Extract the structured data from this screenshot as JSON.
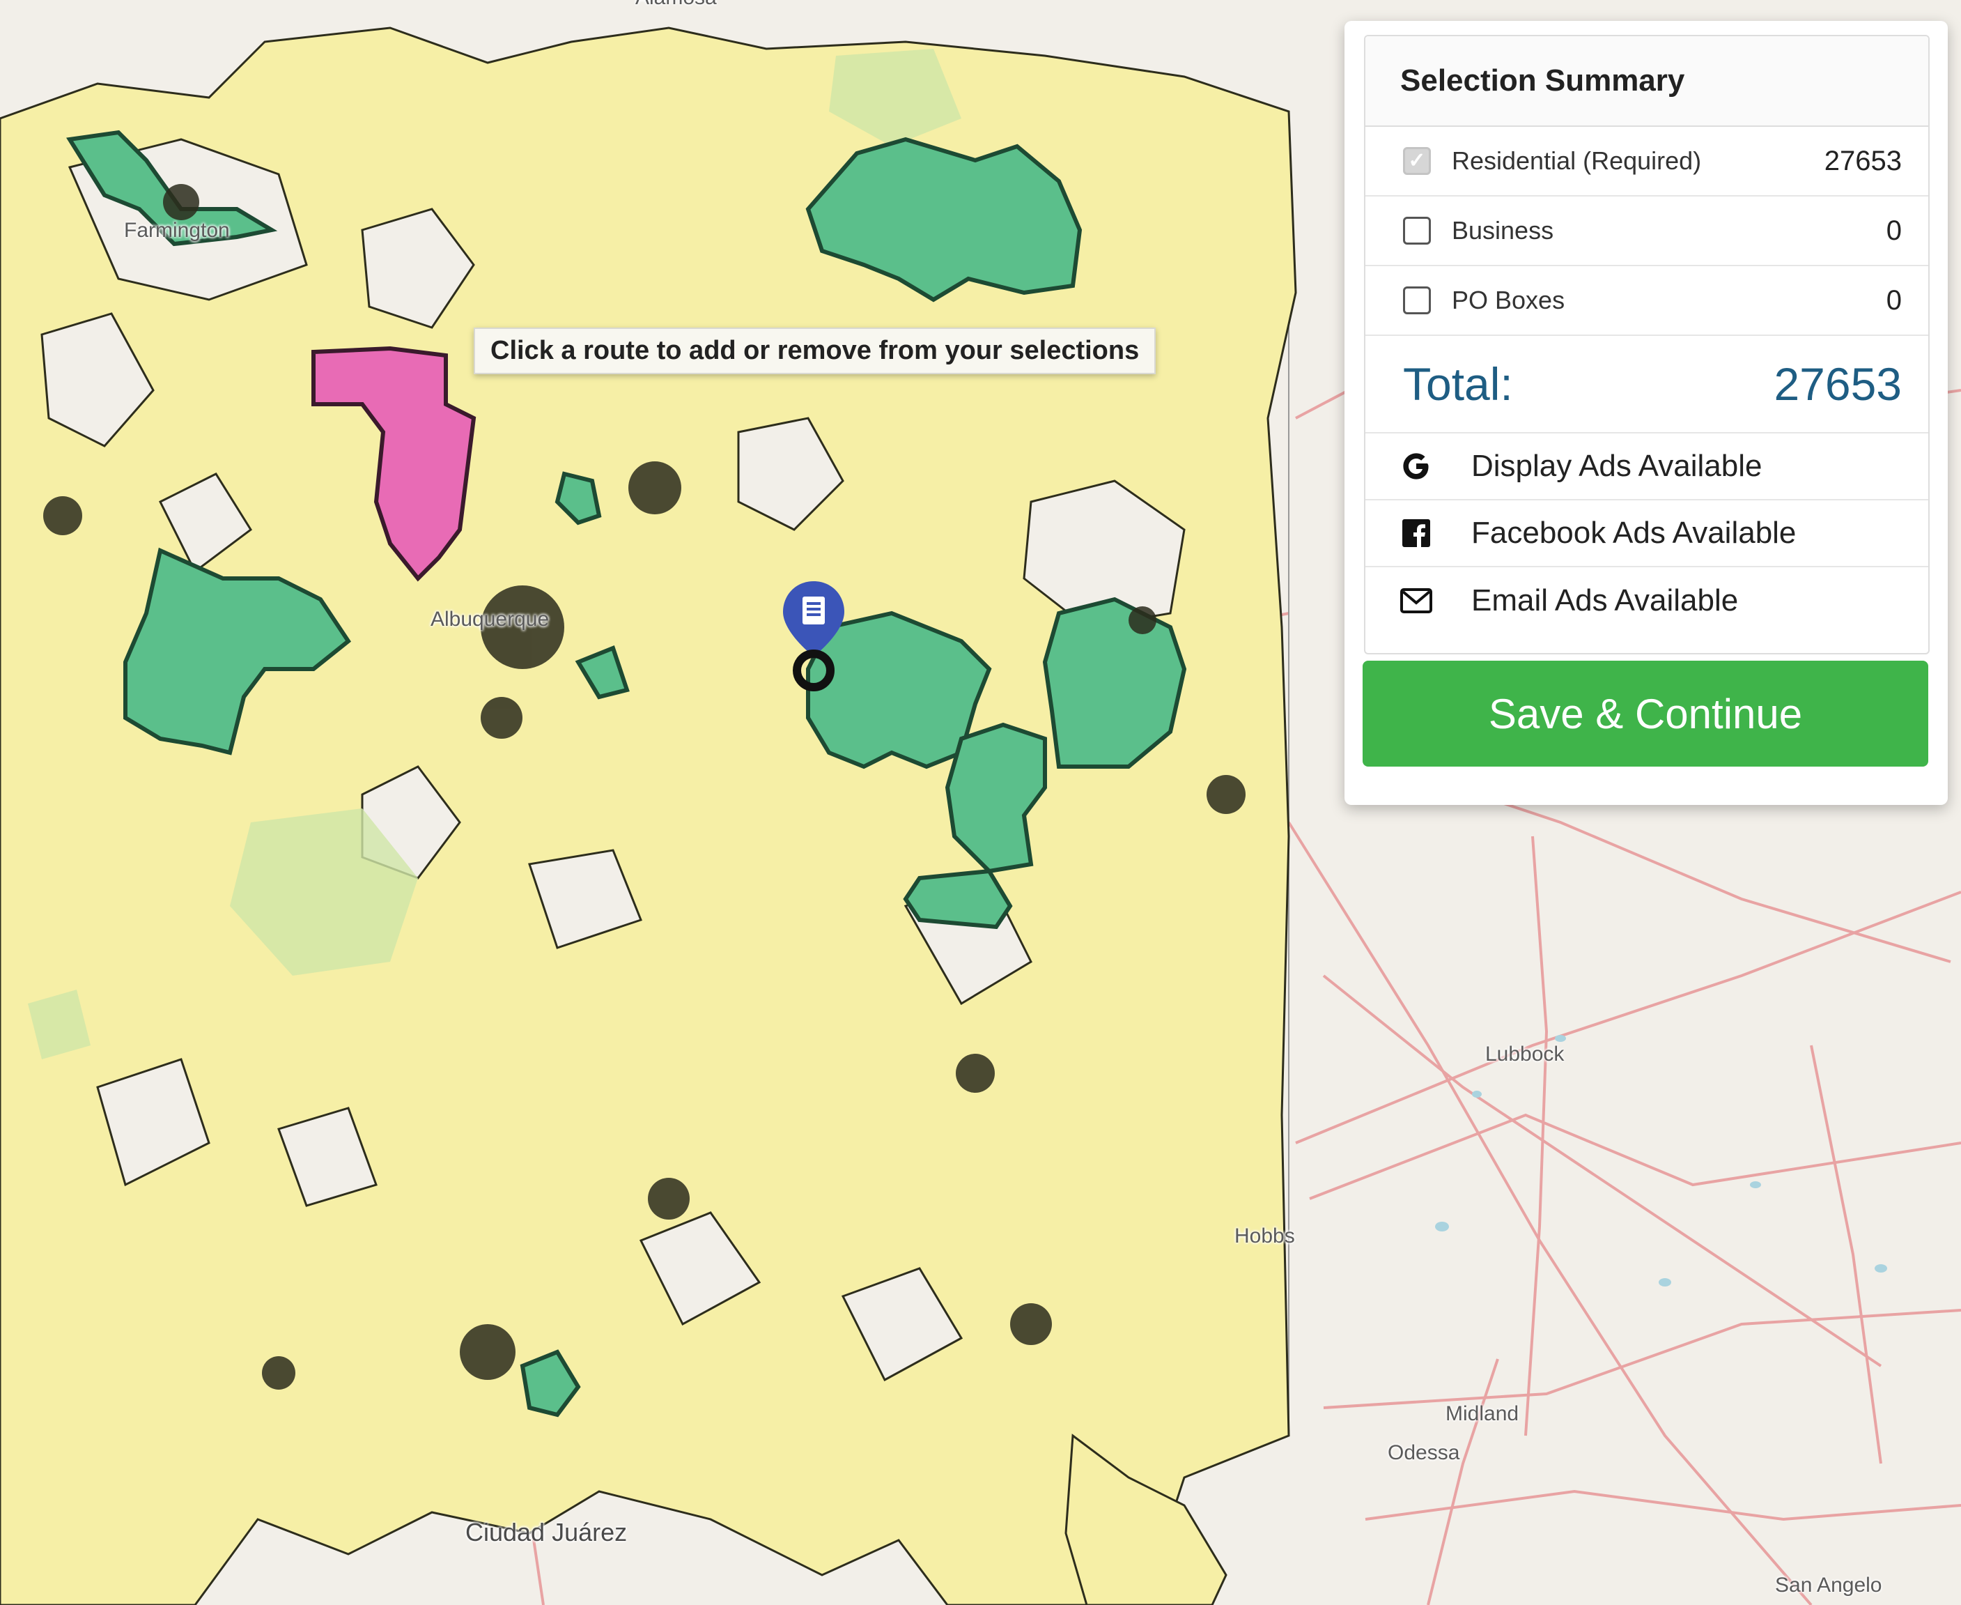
{
  "map": {
    "tooltip": "Click a route to add or remove from your selections",
    "place_labels": [
      {
        "key": "farmington",
        "text": "Farmington"
      },
      {
        "key": "albuquerque",
        "text": "Albuquerque"
      },
      {
        "key": "lubbock",
        "text": "Lubbock"
      },
      {
        "key": "hobbs",
        "text": "Hobbs"
      },
      {
        "key": "midland",
        "text": "Midland"
      },
      {
        "key": "odessa",
        "text": "Odessa"
      },
      {
        "key": "ciudad_juarez",
        "text": "Ciudad Juárez"
      },
      {
        "key": "san_angelo",
        "text": "San Angelo"
      },
      {
        "key": "alamosa",
        "text": "Alamosa"
      }
    ],
    "colors": {
      "base": "#f2efe9",
      "route_unselected": "#f6efa6",
      "route_selected": "#5bbf8b",
      "route_hover": "#e86bb5",
      "road": "#e8a3a3",
      "marker": "#3b55b8"
    }
  },
  "summary": {
    "title": "Selection Summary",
    "rows": [
      {
        "label": "Residential (Required)",
        "value": "27653",
        "checked": true,
        "disabled": true
      },
      {
        "label": "Business",
        "value": "0",
        "checked": false,
        "disabled": false
      },
      {
        "label": "PO Boxes",
        "value": "0",
        "checked": false,
        "disabled": false
      }
    ],
    "total_label": "Total:",
    "total_value": "27653",
    "ads": [
      {
        "icon": "google-icon",
        "label": "Display Ads Available"
      },
      {
        "icon": "facebook-icon",
        "label": "Facebook Ads Available"
      },
      {
        "icon": "envelope-icon",
        "label": "Email Ads Available"
      }
    ]
  },
  "actions": {
    "save_label": "Save & Continue"
  }
}
